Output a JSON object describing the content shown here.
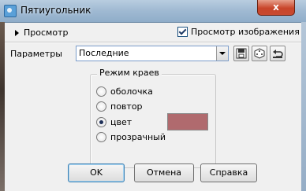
{
  "window": {
    "title": "Пятиугольник",
    "close_label": "x"
  },
  "preview": {
    "toggle_label": "Просмотр",
    "show_image_label": "Просмотр изображения",
    "show_image_checked": true
  },
  "params": {
    "label": "Параметры",
    "selected": "Последние"
  },
  "edge_mode": {
    "title": "Режим краев",
    "options": [
      "оболочка",
      "повтор",
      "цвет",
      "прозрачный"
    ],
    "selected": "цвет",
    "color": "#b06a6e"
  },
  "buttons": {
    "ok": "OK",
    "cancel": "Отмена",
    "help": "Справка"
  }
}
